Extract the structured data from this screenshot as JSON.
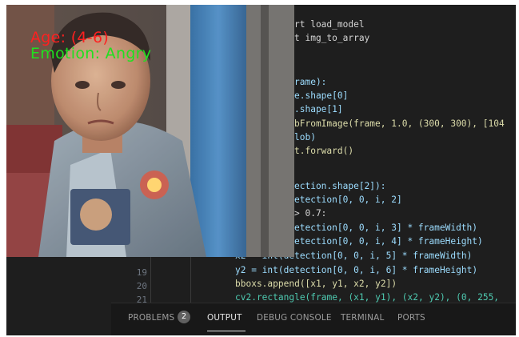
{
  "overlay": {
    "age": "Age: (4-6)",
    "emotion": "Emotion: Angry",
    "age_color": "#ff2020",
    "emotion_color": "#20e020"
  },
  "editor": {
    "line_numbers": [
      "19",
      "20",
      "21"
    ],
    "code": {
      "l1_rest": "rt load_model",
      "l2_rest": "t img_to_array",
      "l3": "rame):",
      "l4": "e.shape[0]",
      "l5": ".shape[1]",
      "l6": "bFromImage(frame, 1.0, (300, 300), [104",
      "l7": "lob)",
      "l8": "t.forward()",
      "l9": "ection.shape[2]):",
      "l10": "etection[0, 0, i, 2]",
      "l11": "> 0.7:",
      "l12": "etection[0, 0, i, 3] * frameWidth)",
      "l13": "etection[0, 0, i, 4] * frameHeight)",
      "l14": "x2 = int(detection[0, 0, i, 5] * frameWidth)",
      "l15": "y2 = int(detection[0, 0, i, 6] * frameHeight)",
      "l16": "bboxs.append([x1, y1, x2, y2])",
      "l17": "cv2.rectangle(frame, (x1, y1), (x2, y2), (0, 255,"
    }
  },
  "panel": {
    "tabs": [
      "PROBLEMS",
      "OUTPUT",
      "DEBUG CONSOLE",
      "TERMINAL",
      "PORTS"
    ],
    "problems_count": "2",
    "active_tab": "OUTPUT"
  }
}
